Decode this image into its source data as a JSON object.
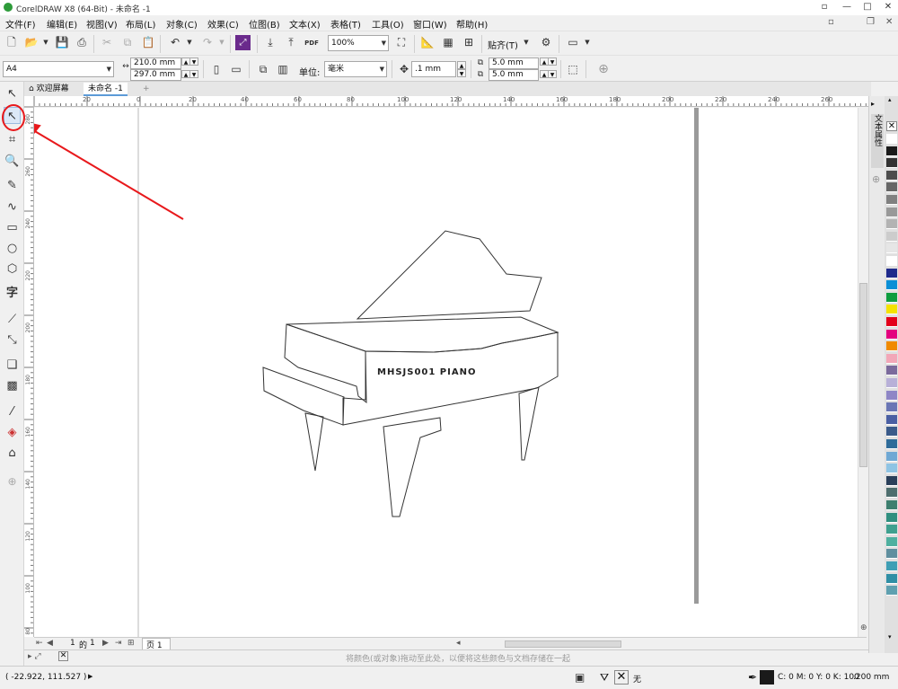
{
  "app": {
    "title": "CorelDRAW X8 (64-Bit) - 未命名 -1"
  },
  "window_controls": {
    "min": "—",
    "max": "□",
    "close": "✕",
    "help": "?"
  },
  "menu": [
    "文件(F)",
    "编辑(E)",
    "视图(V)",
    "布局(L)",
    "对象(C)",
    "效果(C)",
    "位图(B)",
    "文本(X)",
    "表格(T)",
    "工具(O)",
    "窗口(W)",
    "帮助(H)"
  ],
  "toolbar1": {
    "zoom_value": "100%",
    "snap_label": "贴齐(T)",
    "pdf_label": "PDF"
  },
  "toolbar2": {
    "page_size": "A4",
    "width": "210.0 mm",
    "height": "297.0 mm",
    "unit_label": "单位:",
    "unit_value": "毫米",
    "nudge": ".1 mm",
    "dup_x": "5.0 mm",
    "dup_y": "5.0 mm"
  },
  "doc_tabs": {
    "welcome": "欢迎屏幕",
    "active": "未命名 -1"
  },
  "ruler_top": [
    "20",
    "0",
    "20",
    "40",
    "60",
    "80",
    "100",
    "120",
    "140",
    "160",
    "180",
    "200",
    "220",
    "240",
    "260"
  ],
  "ruler_left": [
    "280",
    "260",
    "240",
    "220",
    "200",
    "180",
    "160",
    "140",
    "120",
    "100",
    "80"
  ],
  "drawing": {
    "piano_text": "MHSJS001 PIANO"
  },
  "page_nav": {
    "current": "1",
    "of": "的",
    "total": "1",
    "page_tab": "页 1"
  },
  "status": {
    "hint": "将颜色(或对象)拖动至此处，以便将这些颜色与文档存储在一起",
    "coords": "( -22.922, 111.527 )",
    "fill_none": "无",
    "outline_cmyk": "C: 0 M: 0 Y: 0 K: 100",
    "outline_width": ".200 mm"
  },
  "docker": {
    "label": "文本属性"
  },
  "palette": [
    "#ffffff",
    "#1a1a1a",
    "#333333",
    "#4d4d4d",
    "#666666",
    "#808080",
    "#999999",
    "#b3b3b3",
    "#cccccc",
    "#e6e6e6",
    "#ffffff",
    "#1f2a8c",
    "#0a8fd6",
    "#0e9d3f",
    "#f4e200",
    "#e3001b",
    "#e4007f",
    "#f08a00",
    "#f2a7b8",
    "#7b6a9c",
    "#b8b0d8",
    "#8e86c6",
    "#6a76b5",
    "#4a5fa3",
    "#3a5a8a",
    "#2f6c9a",
    "#6fa8d4",
    "#8fc4e4",
    "#2a3f5a",
    "#4e6e6e",
    "#3d7f6f",
    "#2f8f7f",
    "#3fa08f",
    "#4fb0a0",
    "#5f8f9f",
    "#3f9fb5",
    "#2f8fa5",
    "#5fa0b0"
  ],
  "colors": {
    "accent": "#6a2a8c",
    "annotation": "#e8191c",
    "page_shadow": "#9a9a9a"
  }
}
